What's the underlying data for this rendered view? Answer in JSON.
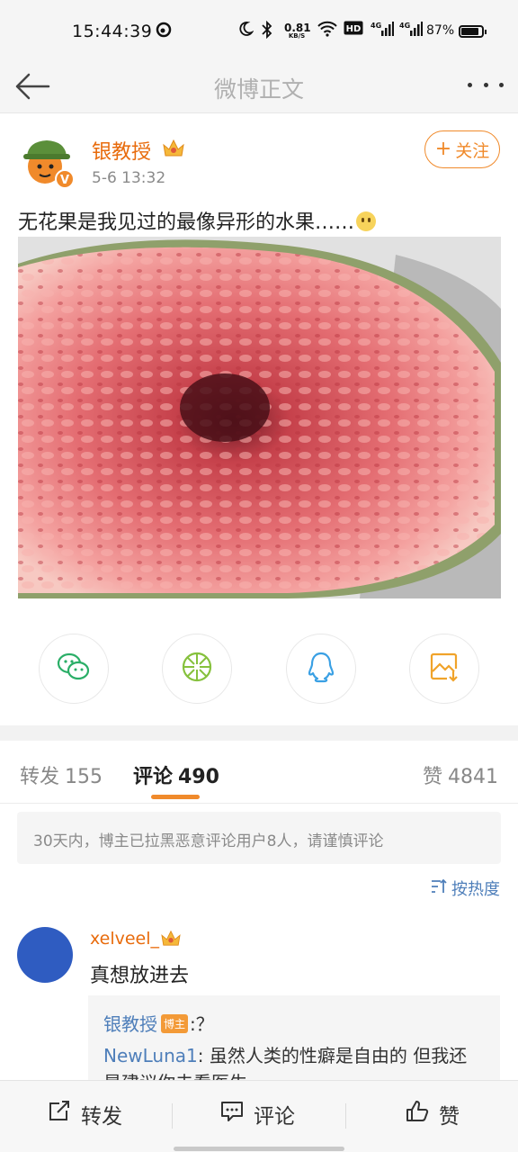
{
  "status_bar": {
    "time": "15:44:39",
    "net_speed": "0.81",
    "net_unit": "KB/S",
    "battery": "87%",
    "battery_level": 0.87,
    "icons": [
      "weibo-notify-icon",
      "moon-icon",
      "bluetooth-icon",
      "wifi-icon",
      "hd-icon",
      "signal-4g-icon",
      "signal-4g-icon",
      "battery-icon"
    ]
  },
  "nav": {
    "title": "微博正文",
    "back_icon": "back-arrow-icon",
    "more_icon": "more-icon"
  },
  "post": {
    "username": "银教授",
    "time": "5-6 13:32",
    "follow_label": "关注",
    "text": "无花果是我见过的最像异形的水果……",
    "image": "fig-photo"
  },
  "share": [
    {
      "name": "wechat-icon",
      "color": "#2aae67"
    },
    {
      "name": "moments-icon",
      "color": "#86c13d"
    },
    {
      "name": "qq-icon",
      "color": "#3aa0e4"
    },
    {
      "name": "save-image-icon",
      "color": "#f0a32a"
    }
  ],
  "tabs": {
    "repost_label": "转发",
    "repost_count": "155",
    "comment_label": "评论",
    "comment_count": "490",
    "like_label": "赞",
    "like_count": "4841"
  },
  "notice": "30天内，博主已拉黑恶意评论用户8人，请谨慎评论",
  "sort_label": "按热度",
  "comment": {
    "username": "xelveel_",
    "text": "真想放进去",
    "replies": [
      {
        "user": "银教授",
        "tag": "博主",
        "text": ":？"
      },
      {
        "user": "NewLuna1",
        "text": ": 虽然人类的性癖是自由的 但我还是建议你去看医生"
      }
    ]
  },
  "bottom_bar": {
    "repost": "转发",
    "comment": "评论",
    "like": "赞"
  },
  "colors": {
    "accent": "#f08a2b",
    "username": "#e86b0c",
    "link_blue": "#4f7fba"
  }
}
